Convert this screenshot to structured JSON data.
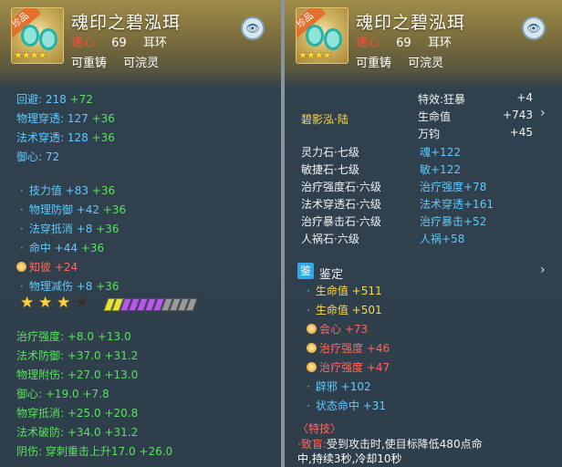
{
  "item": {
    "name": "魂印之碧泓珥",
    "badge": "珍品",
    "warn": "迷心",
    "level": "69",
    "type": "耳环",
    "recast": "可重铸",
    "wash": "可浣灵",
    "view_icon": "eye-icon"
  },
  "left": {
    "base": [
      {
        "name": "回避:",
        "value": "218",
        "bonus": "+72"
      },
      {
        "name": "物理穿透:",
        "value": "127",
        "bonus": "+36"
      },
      {
        "name": "法术穿透:",
        "value": "128",
        "bonus": "+36"
      },
      {
        "name": "御心:",
        "value": "72",
        "bonus": ""
      }
    ],
    "extra": [
      {
        "name": "技力值",
        "value": "+83",
        "bonus": "+36"
      },
      {
        "name": "物理防御",
        "value": "+42",
        "bonus": "+36"
      },
      {
        "name": "法穿抵消",
        "value": "+8",
        "bonus": "+36"
      },
      {
        "name": "命中",
        "value": "+44",
        "bonus": "+36"
      }
    ],
    "special": {
      "name": "知彼",
      "value": "+24"
    },
    "extra2": {
      "name": "物理减伤",
      "value": "+8",
      "bonus": "+36"
    },
    "stars_filled": 3,
    "stars_total": 4,
    "gems": [
      "#e6e23c",
      "#e6e23c",
      "#b35ce6",
      "#b35ce6",
      "#b35ce6",
      "#b35ce6",
      "#b35ce6",
      "#9a9a9a",
      "#9a9a9a",
      "#9a9a9a",
      "#9a9a9a"
    ],
    "refine": [
      {
        "name": "治疗强度:",
        "a": "+8.0",
        "b": "+13.0"
      },
      {
        "name": "法术防御:",
        "a": "+37.0",
        "b": "+31.2"
      },
      {
        "name": "物理附伤:",
        "a": "+27.0",
        "b": "+13.0"
      },
      {
        "name": "御心:",
        "a": "+19.0",
        "b": "+7.8"
      },
      {
        "name": "物穿抵消:",
        "a": "+25.0",
        "b": "+20.8"
      },
      {
        "name": "法术破防:",
        "a": "+34.0",
        "b": "+31.2"
      }
    ],
    "last": {
      "name": "阴伤:",
      "text": "穿刺重击上升17.0",
      "bonus": "+26.0"
    }
  },
  "right": {
    "set_name": "碧影泓·陆",
    "set_effects": [
      {
        "name": "特效:狂暴",
        "value": "+4"
      },
      {
        "name": "生命值",
        "value": "+743"
      },
      {
        "name": "万钧",
        "value": "+45"
      }
    ],
    "stones": [
      {
        "name": "灵力石·七级",
        "effect": "魂+122"
      },
      {
        "name": "敏捷石·七级",
        "effect": "敏+122"
      },
      {
        "name": "治疗强度石·六级",
        "effect": "治疗强度+78"
      },
      {
        "name": "法术穿透石·六级",
        "effect": "法术穿透+161"
      },
      {
        "name": "治疗暴击石·六级",
        "effect": "治疗暴击+52"
      },
      {
        "name": "人祸石·六级",
        "effect": "人祸+58"
      }
    ],
    "appraise_badge": "鉴",
    "appraise_title": "鉴定",
    "appraise": [
      {
        "name": "生命值",
        "value": "+511",
        "kind": "red"
      },
      {
        "name": "生命值",
        "value": "+501",
        "kind": "red"
      },
      {
        "name": "会心",
        "value": "+73",
        "kind": "sun"
      },
      {
        "name": "治疗强度",
        "value": "+46",
        "kind": "sun"
      },
      {
        "name": "治疗强度",
        "value": "+47",
        "kind": "sun"
      },
      {
        "name": "辟邪",
        "value": "+102",
        "kind": "blue"
      },
      {
        "name": "状态命中",
        "value": "+31",
        "kind": "blue"
      }
    ],
    "special_tag": "〈特技〉",
    "special_line1": "·致盲:受到攻击时,使目标降低480点命",
    "special_line2": "中,持续3秒,冷却10秒"
  },
  "colors": {
    "blue": "#5fc9ff",
    "green": "#58e25c",
    "red": "#ff6a5a",
    "yellow": "#ffd64a"
  }
}
